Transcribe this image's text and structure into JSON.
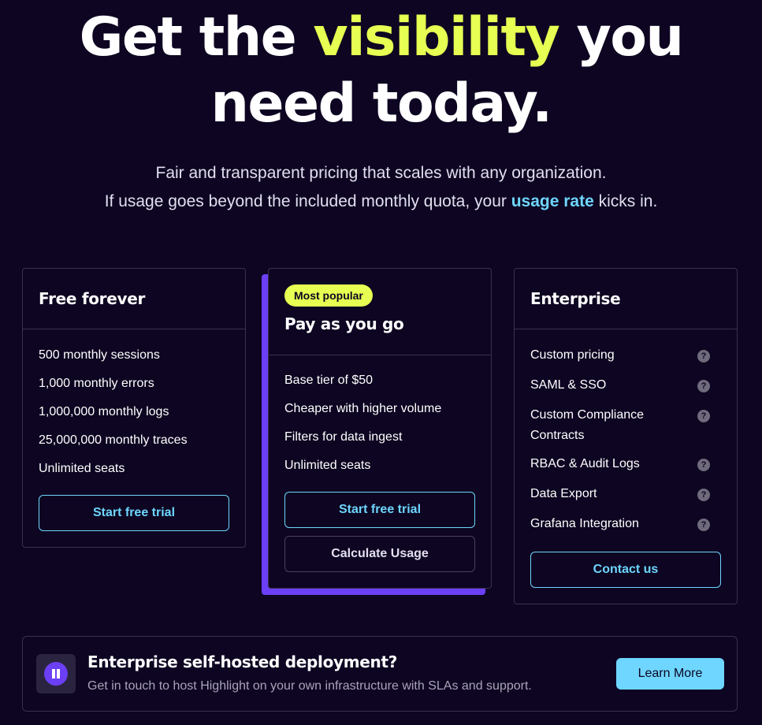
{
  "hero": {
    "title_before": "Get the",
    "title_accent": "visibility",
    "title_after": "you",
    "title_line2": "need today.",
    "subtitle_line1": "Fair and transparent pricing that scales with any organization.",
    "subtitle_line2_before": "If usage goes beyond the included monthly quota, your",
    "subtitle_link": "usage rate",
    "subtitle_line2_after": "kicks in."
  },
  "plans": {
    "free": {
      "title": "Free forever",
      "features": [
        "500 monthly sessions",
        "1,000 monthly errors",
        "1,000,000 monthly logs",
        "25,000,000 monthly traces",
        "Unlimited seats"
      ],
      "cta": "Start free trial"
    },
    "payg": {
      "badge": "Most popular",
      "title": "Pay as you go",
      "features": [
        "Base tier of $50",
        "Cheaper with higher volume",
        "Filters for data ingest",
        "Unlimited seats"
      ],
      "cta": "Start free trial",
      "secondary_cta": "Calculate Usage"
    },
    "enterprise": {
      "title": "Enterprise",
      "features": [
        "Custom pricing",
        "SAML & SSO",
        "Custom Compliance Contracts",
        "RBAC & Audit Logs",
        "Data Export",
        "Grafana Integration"
      ],
      "help_glyph": "?",
      "cta": "Contact us"
    }
  },
  "banner": {
    "title": "Enterprise self-hosted deployment?",
    "text": "Get in touch to host Highlight on your own infrastructure with SLAs and support.",
    "cta": "Learn More",
    "icon": "highlight-logo-icon"
  },
  "colors": {
    "background": "#0d0521",
    "accent_yellow": "#e7ff52",
    "accent_cyan": "#6ed6ff",
    "accent_purple": "#6b3ff5",
    "border": "#3a3152"
  }
}
